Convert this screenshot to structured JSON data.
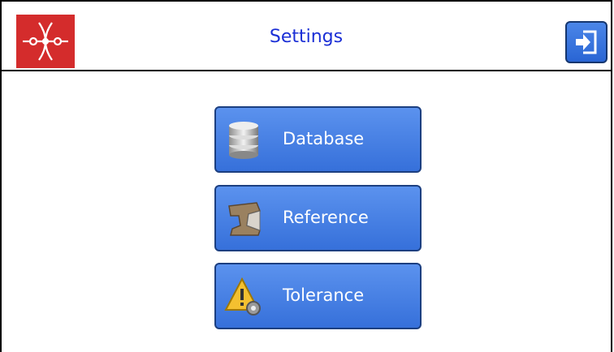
{
  "header": {
    "title": "Settings",
    "logo_icon": "app-logo-icon",
    "exit_icon": "exit-icon"
  },
  "menu": [
    {
      "label": "Database",
      "icon": "database-icon"
    },
    {
      "label": "Reference",
      "icon": "rail-icon"
    },
    {
      "label": "Tolerance",
      "icon": "warning-gear-icon"
    }
  ],
  "colors": {
    "title": "#1b2fd6",
    "button": "#3f78e0",
    "logo": "#d42c2c"
  }
}
